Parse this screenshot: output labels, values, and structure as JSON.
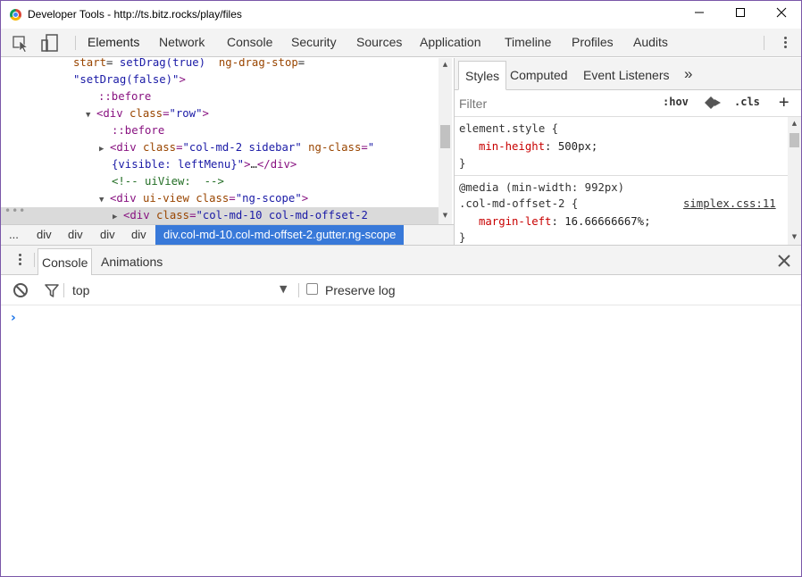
{
  "window": {
    "title": "Developer Tools - http://ts.bitz.rocks/play/files",
    "minimize": "—",
    "maximize": "☐",
    "close": "✕"
  },
  "toolbar": {
    "icons": [
      "inspect-icon",
      "device-toolbar-icon",
      "more-menu-icon"
    ],
    "tabs": [
      "Elements",
      "Network",
      "Console",
      "Security",
      "Sources",
      "Application",
      "Timeline",
      "Profiles",
      "Audits"
    ],
    "active_tab": "Elements"
  },
  "elements": {
    "lines": [
      {
        "indent": 0,
        "parts": [
          [
            "attr",
            "start"
          ],
          [
            "plain",
            "= "
          ],
          [
            "val",
            "setDrag(true)"
          ],
          [
            "plain",
            "  "
          ],
          [
            "attr",
            "ng-drag-stop"
          ],
          [
            "plain",
            "="
          ]
        ]
      },
      {
        "indent": 0,
        "parts": [
          [
            "val",
            "\"setDrag(false)\""
          ],
          [
            "tag",
            ">"
          ]
        ]
      },
      {
        "indent": 1,
        "parts": [
          [
            "pseudo",
            "::before"
          ]
        ]
      },
      {
        "indent": 1,
        "tri": "▼",
        "parts": [
          [
            "tag",
            "<div "
          ],
          [
            "attr",
            "class"
          ],
          [
            "tag",
            "="
          ],
          [
            "val",
            "\"row\""
          ],
          [
            "tag",
            ">"
          ]
        ]
      },
      {
        "indent": 2,
        "parts": [
          [
            "pseudo",
            "::before"
          ]
        ]
      },
      {
        "indent": 2,
        "tri": "▶",
        "parts": [
          [
            "tag",
            "<div "
          ],
          [
            "attr",
            "class"
          ],
          [
            "tag",
            "="
          ],
          [
            "val",
            "\"col-md-2 sidebar\""
          ],
          [
            "plain",
            " "
          ],
          [
            "attr",
            "ng-class"
          ],
          [
            "tag",
            "="
          ],
          [
            "val",
            "\""
          ]
        ]
      },
      {
        "indent": 2,
        "parts": [
          [
            "val",
            "{visible: leftMenu}\""
          ],
          [
            "tag",
            ">"
          ],
          [
            "plain",
            "…"
          ],
          [
            "tag",
            "</div>"
          ]
        ]
      },
      {
        "indent": 2,
        "parts": [
          [
            "comment",
            "<!-- uiView:  -->"
          ]
        ]
      },
      {
        "indent": 2,
        "tri": "▼",
        "parts": [
          [
            "tag",
            "<div "
          ],
          [
            "attr",
            "ui-view"
          ],
          [
            "plain",
            " "
          ],
          [
            "attr",
            "class"
          ],
          [
            "tag",
            "="
          ],
          [
            "val",
            "\"ng-scope\""
          ],
          [
            "tag",
            ">"
          ]
        ]
      },
      {
        "indent": 3,
        "tri": "▶",
        "selected": true,
        "parts": [
          [
            "tag",
            "<div "
          ],
          [
            "attr",
            "class"
          ],
          [
            "tag",
            "="
          ],
          [
            "val",
            "\"col-md-10 col-md-offset-2"
          ]
        ]
      }
    ],
    "overflow_dots": "•••"
  },
  "breadcrumbs": {
    "items": [
      "...",
      "div",
      "div",
      "div",
      "div"
    ],
    "selected": "div.col-md-10.col-md-offset-2.gutter.ng-scope"
  },
  "styles_pane": {
    "tabs": [
      "Styles",
      "Computed",
      "Event Listeners"
    ],
    "more": "»",
    "active_tab": "Styles",
    "filter_placeholder": "Filter",
    "hov": ":hov",
    "cls": ".cls",
    "add": "+",
    "rule1": {
      "selector": "element.style",
      "open": " {",
      "prop": "min-height",
      "value": ": 500px;",
      "close": "}"
    },
    "rule2": {
      "media": "@media (min-width: 992px)",
      "selector": ".col-md-offset-2",
      "open": " {",
      "source": "simplex.css:11",
      "prop": "margin-left",
      "value": ": 16.66666667%;",
      "close": "}"
    }
  },
  "drawer": {
    "tabs": [
      "Console",
      "Animations"
    ],
    "active_tab": "Console",
    "close": "✕",
    "context": "top",
    "context_arrow": "▼",
    "preserve_log": "Preserve log",
    "preserve_checked": false,
    "prompt": "›"
  }
}
